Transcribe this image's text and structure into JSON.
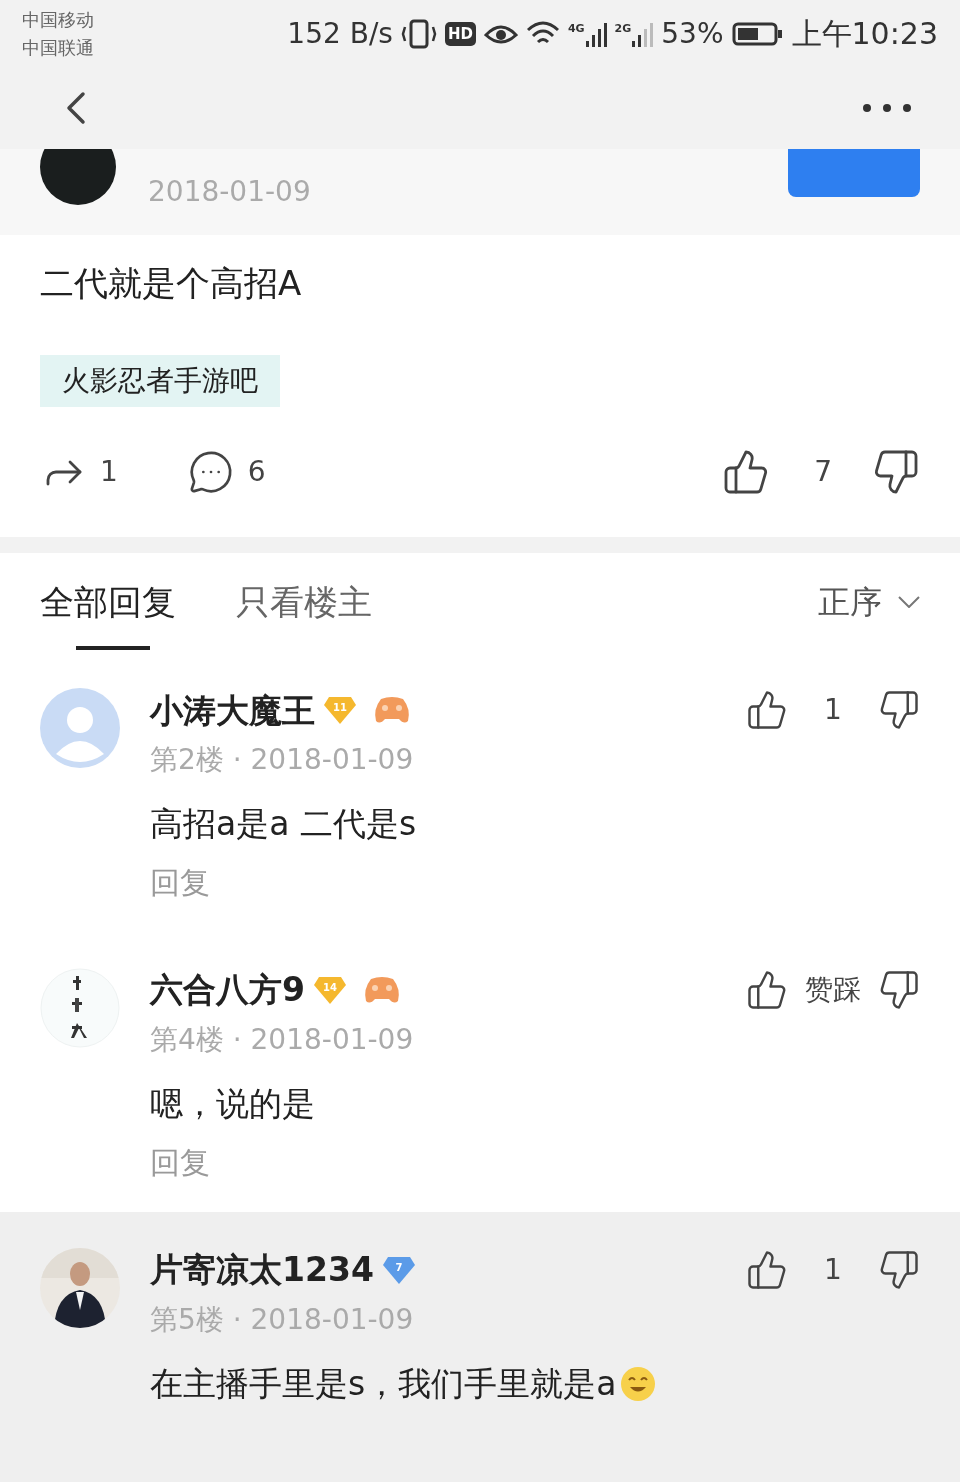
{
  "status_bar": {
    "carriers": [
      "中国移动",
      "中国联通"
    ],
    "speed": "152 B/s",
    "hd": "HD",
    "network_1": "4G",
    "network_2": "2G",
    "battery": "53%",
    "time": "上午10:23"
  },
  "post": {
    "date": "2018-01-09",
    "text": "二代就是个高招A",
    "forum_tag": "火影忍者手游吧",
    "shares": "1",
    "comments": "6",
    "likes": "7"
  },
  "tabs": [
    {
      "label": "全部回复",
      "selected": true
    },
    {
      "label": "只看楼主",
      "selected": false
    }
  ],
  "sort": "正序",
  "replies": [
    {
      "name": "小涛大魔王",
      "level": "11",
      "color": "#f5b82e",
      "game_badge": true,
      "meta": "第2楼 · 2018-01-09",
      "text": "高招a是a 二代是s",
      "vote": "1",
      "reply": "回复",
      "emoji": false
    },
    {
      "name": "六合八方9",
      "level": "14",
      "color": "#f5b82e",
      "game_badge": true,
      "meta": "第4楼 · 2018-01-09",
      "text": "嗯，说的是",
      "vote": "赞踩",
      "reply": "回复",
      "emoji": false
    },
    {
      "name": "片寄凉太1234",
      "level": "7",
      "color": "#5b9be8",
      "game_badge": false,
      "meta": "第5楼 · 2018-01-09",
      "text": "在主播手里是s，我们手里就是a",
      "vote": "1",
      "emoji": true
    }
  ]
}
